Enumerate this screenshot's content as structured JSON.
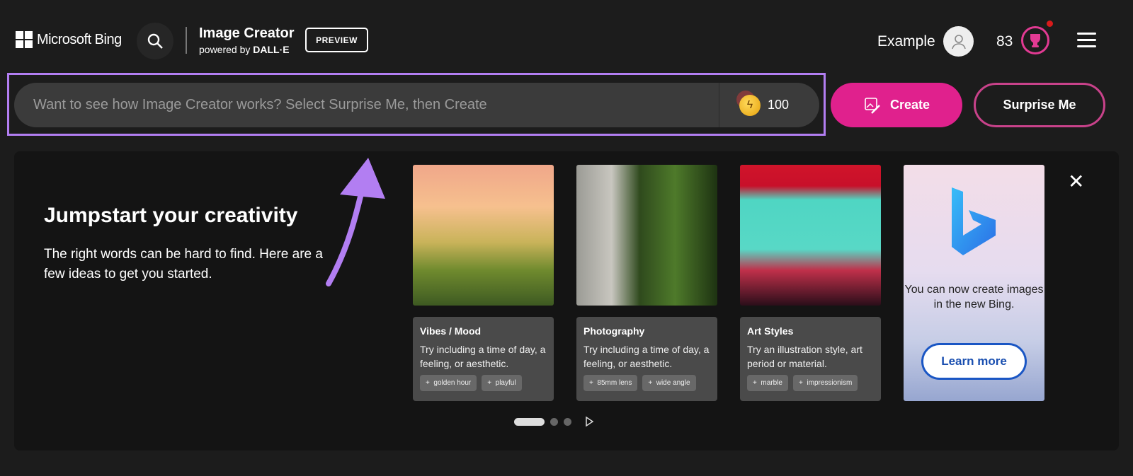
{
  "header": {
    "brand": "Microsoft Bing",
    "title": "Image Creator",
    "subtitle_prefix": "powered by ",
    "subtitle_brand": "DALL·E",
    "badge": "PREVIEW",
    "user_name": "Example",
    "points": "83"
  },
  "prompt": {
    "placeholder": "Want to see how Image Creator works? Select Surprise Me, then Create",
    "value": "",
    "boosts": "100"
  },
  "buttons": {
    "create": "Create",
    "surprise": "Surprise Me"
  },
  "accent": "#e0218d",
  "highlight": "#b27ef2",
  "jumpstart": {
    "title": "Jumpstart your creativity",
    "text": "The right words can be hard to find. Here are a few ideas to get you started."
  },
  "cards": [
    {
      "title": "Vibes / Mood",
      "desc": "Try including a time of day, a feeling, or aesthetic.",
      "chips": [
        "golden hour",
        "playful"
      ]
    },
    {
      "title": "Photography",
      "desc": "Try including a time of day, a feeling, or aesthetic.",
      "chips": [
        "85mm lens",
        "wide angle"
      ]
    },
    {
      "title": "Art Styles",
      "desc": "Try an illustration style, art period or material.",
      "chips": [
        "marble",
        "impressionism"
      ]
    }
  ],
  "promo": {
    "message": "You can now create images in the new Bing.",
    "button": "Learn more"
  },
  "pagination": {
    "pages": 3,
    "current": 1
  }
}
